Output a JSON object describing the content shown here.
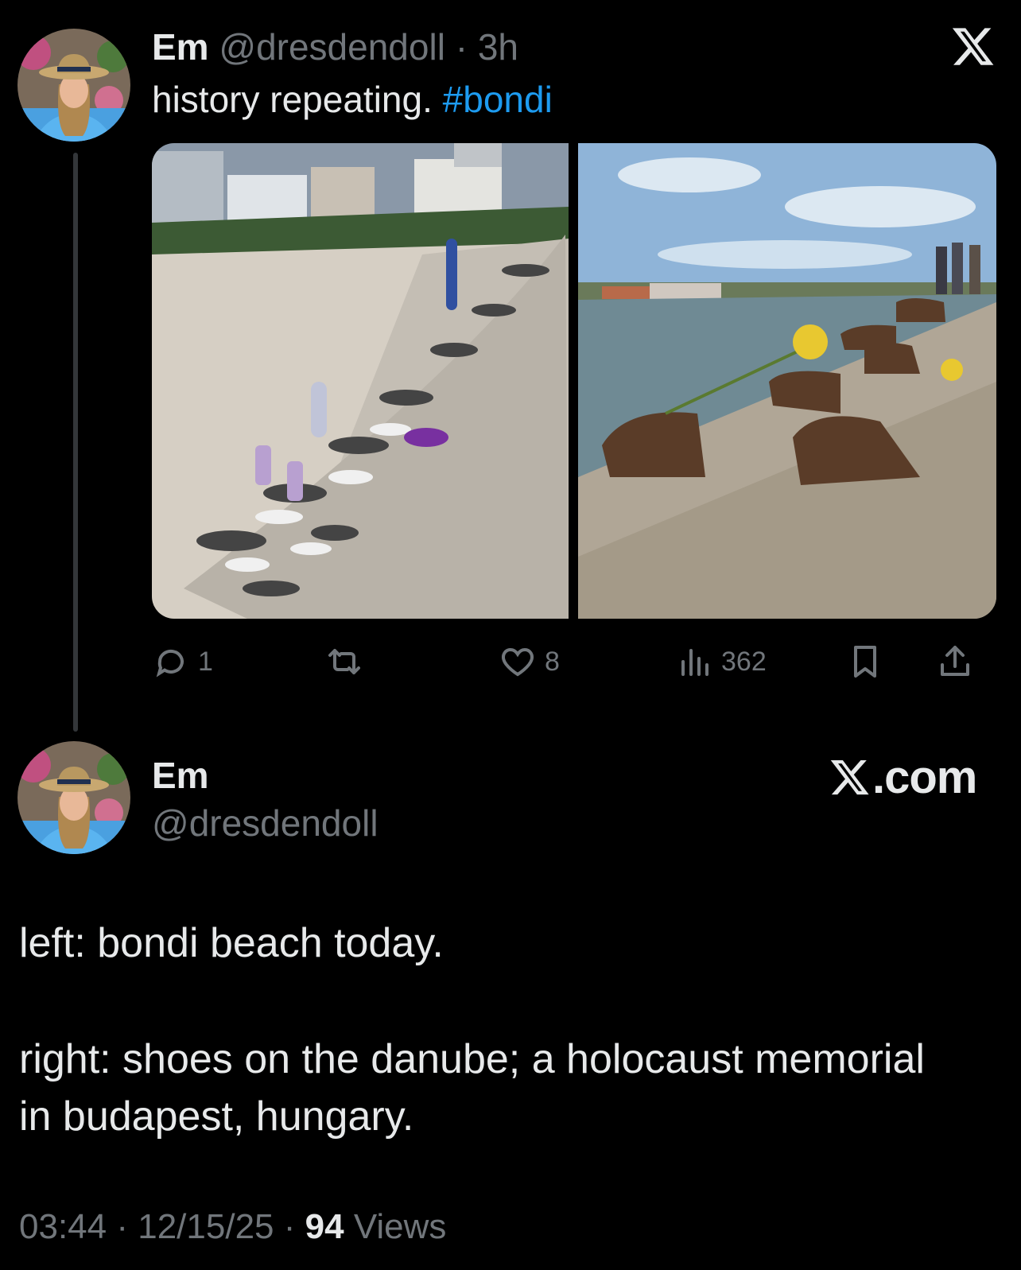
{
  "tweet": {
    "display_name": "Em",
    "handle": "@dresdendoll",
    "separator": "·",
    "time_ago": "3h",
    "text": "history repeating.",
    "hashtag": "#bondi",
    "avatar_icon": "profile-photo-woman-straw-hat",
    "close_icon": "x-logo-icon",
    "media": [
      {
        "icon": "photo-bondi-beach-shoes"
      },
      {
        "icon": "photo-shoes-on-the-danube"
      }
    ],
    "actions": {
      "reply_count": "1",
      "repost_count": "",
      "like_count": "8",
      "views_count": "362"
    }
  },
  "author_card": {
    "display_name": "Em",
    "handle": "@dresdendoll",
    "brand": ".com",
    "brand_icon": "x-logo-icon"
  },
  "body": {
    "line1": "left: bondi beach today.",
    "line2": "right: shoes on the danube; a holocaust memorial",
    "line3": "in budapest, hungary."
  },
  "meta": {
    "time": "03:44",
    "sep1": "·",
    "date": "12/15/25",
    "sep2": "·",
    "views_count": "94",
    "views_label": "Views"
  },
  "colors": {
    "background": "#000000",
    "text": "#e7e9ea",
    "muted": "#71767b",
    "link": "#1d9bf0"
  }
}
